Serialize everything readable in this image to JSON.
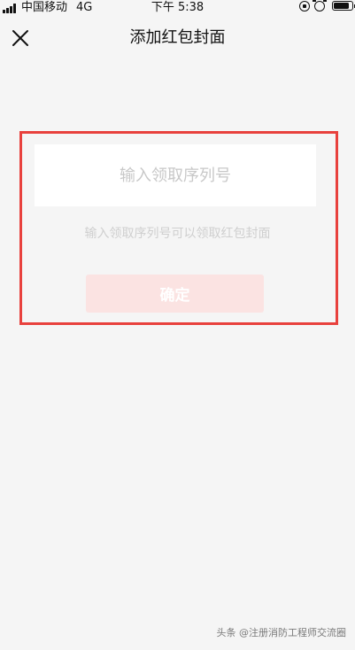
{
  "status_bar": {
    "carrier": "中国移动",
    "network": "4G",
    "time": "下午 5:38",
    "battery_level": 0.85
  },
  "nav": {
    "title": "添加红包封面"
  },
  "form": {
    "input_placeholder": "输入领取序列号",
    "input_value": "",
    "hint": "输入领取序列号可以领取红包封面",
    "confirm_label": "确定"
  },
  "watermark": {
    "text": "头条 @注册消防工程师交流圈"
  },
  "colors": {
    "highlight_border": "#e8413d",
    "confirm_button_bg": "#fbe3e2",
    "page_background": "#f5f5f5"
  }
}
